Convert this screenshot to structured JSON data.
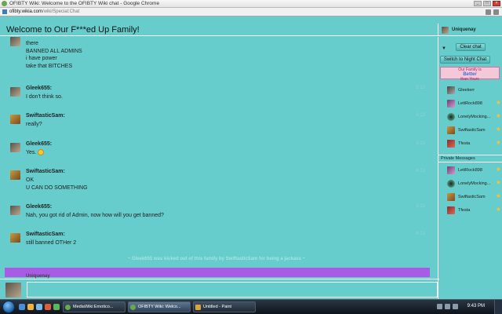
{
  "window": {
    "title": "OFIBTY Wiki: Welcome to the OFIBTY Wiki chat - Google Chrome"
  },
  "address_bar": {
    "host": "ofibty.wikia.com",
    "path": "/wiki/Special:Chat"
  },
  "chat": {
    "room_title": "Welcome to Our F***ed Up Family!",
    "current_user": "Uniquenay",
    "messages": [
      {
        "sender": "",
        "time": "",
        "lines": [
          "there",
          "BANNED ALL ADMINS",
          "i have power",
          "take that BITCHES"
        ]
      },
      {
        "sender": "Gleek655:",
        "time": "9:13",
        "lines": [
          "I don't think so."
        ]
      },
      {
        "sender": "SwiftasticSam:",
        "time": "9:13",
        "lines": [
          "really?"
        ]
      },
      {
        "sender": "Gleek655:",
        "time": "9:13",
        "lines": [
          "Yes."
        ]
      },
      {
        "sender": "SwiftasticSam:",
        "time": "9:13",
        "lines": [
          "OK",
          "U CAN DO SOMETHING"
        ]
      },
      {
        "sender": "Gleek655:",
        "time": "9:13",
        "lines": [
          "Nah, you got rid of Admin, now how will you get banned?"
        ]
      },
      {
        "sender": "SwiftasticSam:",
        "time": "9:13",
        "lines": [
          "still banned OTHer 2"
        ]
      }
    ],
    "inline_alert": "~ Gleek655 was kicked out of this family by SwiftasticSam for being a jackass ~",
    "partial_sender": "Uniquenay"
  },
  "rail": {
    "clear_chat_label": "Clear chat",
    "night_chat_label": "Switch to Night Chat",
    "banner": {
      "line1": "Our Family is",
      "line2": "Better",
      "line3": "than Yours"
    },
    "users": [
      {
        "name": "Gleekerr",
        "star": false
      },
      {
        "name": "LettRock898",
        "star": true
      },
      {
        "name": "LonelyMocking...",
        "star": true
      },
      {
        "name": "SwiftasticSam",
        "star": true
      },
      {
        "name": "Tfesta",
        "star": true
      }
    ],
    "pm_header": "Private Messages",
    "private_messages": [
      {
        "name": "LettRock898",
        "star": true
      },
      {
        "name": "LonelyMocking...",
        "star": true
      },
      {
        "name": "SwiftasticSam",
        "star": true
      },
      {
        "name": "Tfesta",
        "star": true
      }
    ]
  },
  "taskbar": {
    "tasks": [
      {
        "label": "MediaWiki:Emotico..."
      },
      {
        "label": "OFIBTY Wiki: Welco..."
      },
      {
        "label": "Untitled - Paint"
      }
    ],
    "clock": "9:43 PM"
  },
  "colors": {
    "chat_background": "#66cccc",
    "highlight_row": "#a85ce6",
    "star": "#f5c431"
  }
}
